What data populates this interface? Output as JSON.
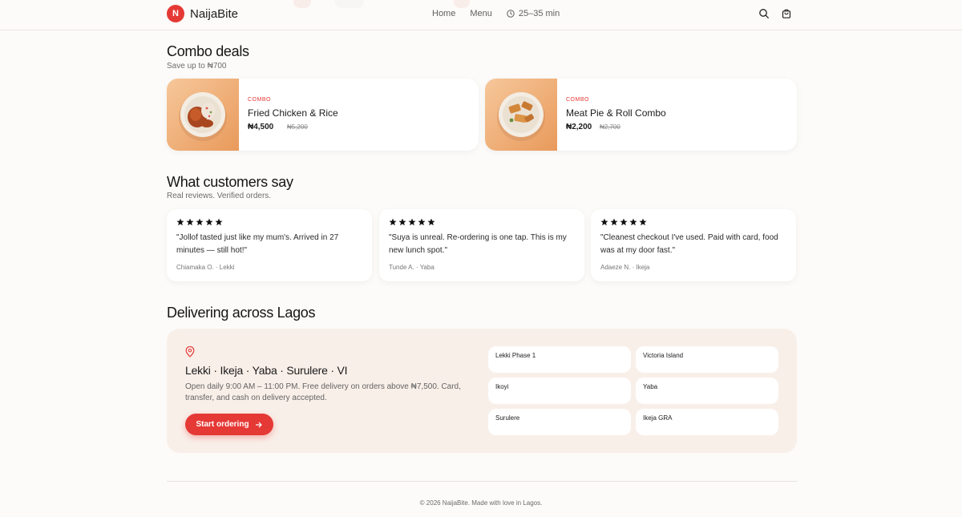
{
  "header": {
    "brand_initial": "N",
    "brand_name": "NaijaBite",
    "nav": [
      "Home",
      "Menu"
    ],
    "eta": "25–35 min",
    "icons": [
      "search-icon",
      "bag-icon",
      "clock-icon"
    ]
  },
  "combos": {
    "title": "Combo deals",
    "subtitle": "Save up to ₦700",
    "items": [
      {
        "tag": "COMBO",
        "name": "Fried Chicken & Rice",
        "price": "₦4,500",
        "old_price": "₦5,200"
      },
      {
        "tag": "COMBO",
        "name": "Meat Pie & Roll Combo",
        "price": "₦2,200",
        "old_price": "₦2,700"
      }
    ]
  },
  "reviews": {
    "title": "What customers say",
    "subtitle": "Real reviews. Verified orders.",
    "items": [
      {
        "stars": 5,
        "quote": "\"Jollof tasted just like my mum's. Arrived in 27 minutes — still hot!\"",
        "author": "Chiamaka O. · Lekki"
      },
      {
        "stars": 5,
        "quote": "\"Suya is unreal. Re-ordering is one tap. This is my new lunch spot.\"",
        "author": "Tunde A. · Yaba"
      },
      {
        "stars": 5,
        "quote": "\"Cleanest checkout I've used. Paid with card, food was at my door fast.\"",
        "author": "Adaeze N. · Ikeja"
      }
    ]
  },
  "delivery": {
    "title": "Delivering across Lagos",
    "areas_line": "Lekki · Ikeja · Yaba · Surulere · VI",
    "description": "Open daily 9:00 AM – 11:00 PM. Free delivery on orders above ₦7,500. Card, transfer, and cash on delivery accepted.",
    "cta": "Start ordering",
    "chips": [
      "Lekki Phase 1",
      "Victoria Island",
      "Ikoyi",
      "Yaba",
      "Surulere",
      "Ikeja GRA"
    ]
  },
  "footer": {
    "text": "© 2026 NaijaBite. Made with love in Lagos."
  },
  "colors": {
    "accent": "#e53935",
    "background": "#fcfbf9",
    "panel": "#f9efe9"
  }
}
